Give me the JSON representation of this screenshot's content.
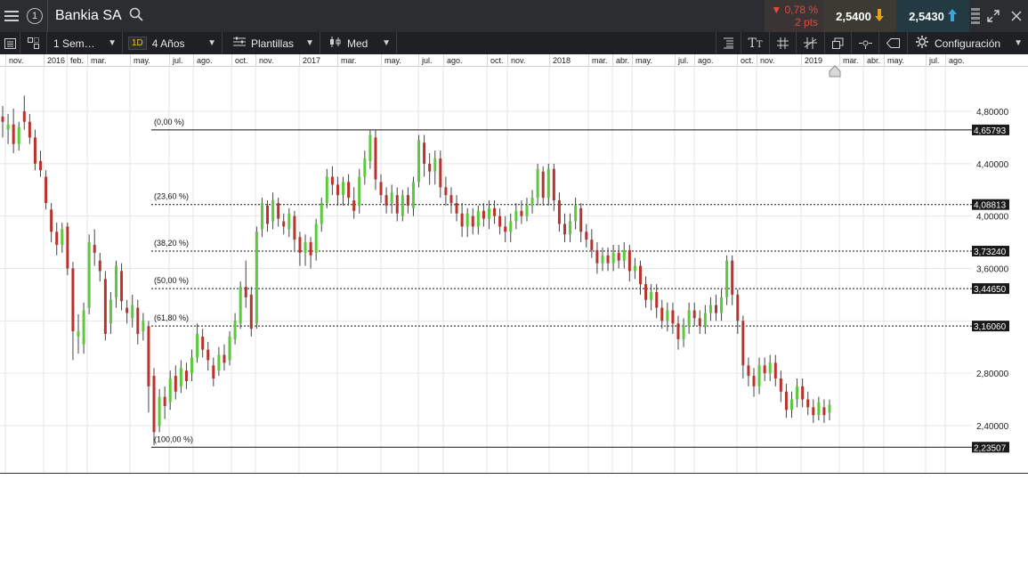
{
  "header": {
    "symbol": "Bankia SA",
    "change_pct": "▼ 0,78 %",
    "change_pts": "2 pts",
    "sell_price": "2,5400",
    "buy_price": "2,5430",
    "info_glyph": "1"
  },
  "toolbar": {
    "interval": "1 Sem…",
    "badge": "1D",
    "range": "4 Años",
    "templates": "Plantillas",
    "price_type": "Med",
    "config": "Configuración"
  },
  "icons": [
    "menu-icon",
    "info-icon",
    "search-icon",
    "list-icon",
    "layout-icon",
    "templates-icon",
    "candles-icon",
    "indicator-icon",
    "text-size-icon",
    "grid-icon",
    "drawing-icon",
    "windows-icon",
    "crosshair-icon",
    "eraser-icon",
    "gear-icon",
    "expand-icon",
    "close-icon",
    "arrow-down-icon",
    "arrow-up-icon"
  ],
  "colors": {
    "up_candle": "#5cc83c",
    "down_candle": "#b8332e",
    "loss": "#e04b3a",
    "sell_bg": "#3b3a33",
    "buy_bg": "#233a42"
  },
  "time_axis": [
    "nov.",
    "2016",
    "feb.",
    "mar.",
    "may.",
    "jul.",
    "ago.",
    "oct.",
    "nov.",
    "2017",
    "mar.",
    "may.",
    "jul.",
    "ago.",
    "oct.",
    "nov.",
    "2018",
    "mar.",
    "abr.",
    "may.",
    "jul.",
    "ago.",
    "oct.",
    "nov.",
    "2019",
    "mar.",
    "abr.",
    "may.",
    "jul.",
    "ago."
  ],
  "chart_data": {
    "type": "candlestick",
    "y_ticks": [
      "4,80000",
      "4,40000",
      "4,00000",
      "3,60000",
      "2,80000",
      "2,40000"
    ],
    "ylim": [
      2.15,
      5.15
    ],
    "fibonacci": {
      "levels": [
        {
          "label": "(0,00 %)",
          "value": 4.65793,
          "tag": "4,65793",
          "style": "solid"
        },
        {
          "label": "(23,60 %)",
          "value": 4.08813,
          "tag": "4,08813",
          "style": "dotted"
        },
        {
          "label": "(38,20 %)",
          "value": 3.7324,
          "tag": "3,73240",
          "style": "dotted"
        },
        {
          "label": "(50,00 %)",
          "value": 3.4465,
          "tag": "3,44650",
          "style": "dotted"
        },
        {
          "label": "(61,80 %)",
          "value": 3.1606,
          "tag": "3,16060",
          "style": "dotted"
        },
        {
          "label": "(100,00 %)",
          "value": 2.23507,
          "tag": "2,23507",
          "style": "solid"
        }
      ]
    },
    "candles": [
      [
        4.76,
        4.72,
        4.6,
        4.84
      ],
      [
        4.66,
        4.7,
        4.55,
        4.78
      ],
      [
        4.7,
        4.55,
        4.48,
        4.82
      ],
      [
        4.55,
        4.68,
        4.5,
        4.72
      ],
      [
        4.8,
        4.72,
        4.66,
        4.92
      ],
      [
        4.72,
        4.6,
        4.55,
        4.78
      ],
      [
        4.6,
        4.4,
        4.35,
        4.66
      ],
      [
        4.42,
        4.35,
        4.3,
        4.5
      ],
      [
        4.3,
        4.1,
        4.05,
        4.35
      ],
      [
        4.05,
        3.88,
        3.8,
        4.1
      ],
      [
        3.88,
        3.78,
        3.7,
        3.95
      ],
      [
        3.78,
        3.9,
        3.72,
        3.95
      ],
      [
        3.92,
        3.6,
        3.55,
        3.95
      ],
      [
        3.6,
        3.12,
        2.9,
        3.65
      ],
      [
        3.08,
        3.12,
        2.95,
        3.25
      ],
      [
        3.02,
        3.28,
        2.95,
        3.34
      ],
      [
        3.3,
        3.8,
        3.25,
        3.86
      ],
      [
        3.78,
        3.72,
        3.62,
        3.9
      ],
      [
        3.66,
        3.58,
        3.5,
        3.72
      ],
      [
        3.52,
        3.1,
        3.05,
        3.58
      ],
      [
        3.18,
        3.36,
        3.1,
        3.42
      ],
      [
        3.38,
        3.62,
        3.3,
        3.66
      ],
      [
        3.58,
        3.35,
        3.28,
        3.64
      ],
      [
        3.3,
        3.26,
        3.18,
        3.36
      ],
      [
        3.22,
        3.32,
        3.15,
        3.4
      ],
      [
        3.3,
        3.1,
        3.02,
        3.36
      ],
      [
        3.12,
        3.2,
        3.05,
        3.26
      ],
      [
        3.16,
        2.7,
        2.5,
        3.2
      ],
      [
        2.78,
        2.35,
        2.25,
        2.84
      ],
      [
        2.4,
        2.62,
        2.35,
        2.68
      ],
      [
        2.62,
        2.55,
        2.45,
        2.7
      ],
      [
        2.58,
        2.76,
        2.52,
        2.82
      ],
      [
        2.78,
        2.66,
        2.6,
        2.86
      ],
      [
        2.7,
        2.84,
        2.65,
        2.9
      ],
      [
        2.82,
        2.74,
        2.68,
        2.88
      ],
      [
        2.8,
        2.92,
        2.74,
        2.98
      ],
      [
        2.92,
        3.1,
        2.88,
        3.18
      ],
      [
        3.08,
        2.98,
        2.92,
        3.14
      ],
      [
        2.98,
        2.9,
        2.82,
        3.04
      ],
      [
        2.86,
        2.76,
        2.7,
        2.92
      ],
      [
        2.82,
        2.94,
        2.78,
        3.0
      ],
      [
        2.94,
        2.88,
        2.82,
        3.02
      ],
      [
        2.9,
        3.08,
        2.86,
        3.12
      ],
      [
        3.06,
        3.2,
        3.02,
        3.26
      ],
      [
        3.18,
        3.46,
        3.14,
        3.5
      ],
      [
        3.46,
        3.38,
        3.3,
        3.66
      ],
      [
        3.4,
        3.14,
        3.08,
        3.46
      ],
      [
        3.18,
        3.88,
        3.14,
        3.92
      ],
      [
        3.9,
        4.1,
        3.84,
        4.14
      ],
      [
        4.08,
        3.94,
        3.88,
        4.12
      ],
      [
        3.96,
        4.12,
        3.9,
        4.18
      ],
      [
        4.1,
        3.98,
        3.92,
        4.14
      ],
      [
        3.96,
        3.92,
        3.86,
        4.02
      ],
      [
        3.9,
        4.02,
        3.84,
        4.06
      ],
      [
        4.0,
        3.82,
        3.74,
        4.04
      ],
      [
        3.84,
        3.72,
        3.62,
        3.88
      ],
      [
        3.72,
        3.8,
        3.62,
        3.86
      ],
      [
        3.8,
        3.7,
        3.6,
        3.84
      ],
      [
        3.72,
        3.94,
        3.66,
        3.98
      ],
      [
        3.94,
        4.1,
        3.88,
        4.14
      ],
      [
        4.1,
        4.3,
        4.06,
        4.36
      ],
      [
        4.3,
        4.24,
        4.16,
        4.38
      ],
      [
        4.24,
        4.16,
        4.08,
        4.3
      ],
      [
        4.16,
        4.26,
        4.08,
        4.3
      ],
      [
        4.26,
        4.14,
        4.08,
        4.32
      ],
      [
        4.12,
        4.04,
        3.98,
        4.22
      ],
      [
        4.08,
        4.3,
        4.02,
        4.36
      ],
      [
        4.3,
        4.44,
        4.24,
        4.5
      ],
      [
        4.42,
        4.62,
        4.36,
        4.66
      ],
      [
        4.6,
        4.28,
        4.2,
        4.66
      ],
      [
        4.26,
        4.16,
        4.1,
        4.32
      ],
      [
        4.16,
        4.08,
        4.02,
        4.22
      ],
      [
        4.1,
        4.18,
        4.02,
        4.24
      ],
      [
        4.16,
        4.02,
        3.96,
        4.22
      ],
      [
        4.0,
        4.16,
        3.96,
        4.2
      ],
      [
        4.16,
        4.08,
        4.02,
        4.22
      ],
      [
        4.06,
        4.26,
        4.0,
        4.3
      ],
      [
        4.26,
        4.58,
        4.22,
        4.62
      ],
      [
        4.56,
        4.4,
        4.3,
        4.62
      ],
      [
        4.4,
        4.34,
        4.24,
        4.48
      ],
      [
        4.34,
        4.44,
        4.24,
        4.5
      ],
      [
        4.44,
        4.22,
        4.14,
        4.5
      ],
      [
        4.22,
        4.16,
        4.08,
        4.3
      ],
      [
        4.16,
        4.1,
        4.02,
        4.22
      ],
      [
        4.1,
        4.02,
        3.96,
        4.16
      ],
      [
        4.02,
        3.92,
        3.84,
        4.1
      ],
      [
        3.92,
        4.02,
        3.84,
        4.06
      ],
      [
        4.0,
        3.92,
        3.86,
        4.06
      ],
      [
        3.92,
        4.04,
        3.86,
        4.08
      ],
      [
        4.04,
        3.98,
        3.92,
        4.1
      ],
      [
        3.98,
        4.06,
        3.9,
        4.12
      ],
      [
        4.06,
        4.0,
        3.94,
        4.12
      ],
      [
        4.0,
        3.92,
        3.86,
        4.06
      ],
      [
        3.92,
        3.88,
        3.8,
        4.0
      ],
      [
        3.88,
        3.96,
        3.8,
        4.02
      ],
      [
        3.96,
        4.04,
        3.9,
        4.1
      ],
      [
        4.04,
        4.0,
        3.94,
        4.12
      ],
      [
        4.0,
        4.08,
        3.96,
        4.14
      ],
      [
        4.08,
        4.14,
        4.02,
        4.2
      ],
      [
        4.14,
        4.36,
        4.08,
        4.4
      ],
      [
        4.34,
        4.14,
        4.08,
        4.38
      ],
      [
        4.14,
        4.36,
        4.08,
        4.4
      ],
      [
        4.36,
        4.12,
        4.04,
        4.4
      ],
      [
        4.12,
        3.94,
        3.88,
        4.18
      ],
      [
        3.94,
        3.86,
        3.8,
        4.02
      ],
      [
        3.86,
        3.96,
        3.8,
        4.02
      ],
      [
        3.96,
        4.08,
        3.9,
        4.14
      ],
      [
        4.06,
        3.88,
        3.8,
        4.1
      ],
      [
        3.88,
        3.82,
        3.76,
        3.94
      ],
      [
        3.82,
        3.74,
        3.68,
        3.9
      ],
      [
        3.74,
        3.64,
        3.56,
        3.8
      ],
      [
        3.64,
        3.7,
        3.58,
        3.76
      ],
      [
        3.7,
        3.64,
        3.58,
        3.76
      ],
      [
        3.64,
        3.72,
        3.58,
        3.78
      ],
      [
        3.72,
        3.66,
        3.6,
        3.78
      ],
      [
        3.66,
        3.74,
        3.6,
        3.8
      ],
      [
        3.74,
        3.58,
        3.5,
        3.78
      ],
      [
        3.58,
        3.62,
        3.52,
        3.68
      ],
      [
        3.62,
        3.48,
        3.4,
        3.66
      ],
      [
        3.48,
        3.36,
        3.3,
        3.54
      ],
      [
        3.36,
        3.42,
        3.28,
        3.48
      ],
      [
        3.42,
        3.3,
        3.22,
        3.48
      ],
      [
        3.3,
        3.2,
        3.14,
        3.36
      ],
      [
        3.2,
        3.28,
        3.12,
        3.34
      ],
      [
        3.28,
        3.18,
        3.1,
        3.34
      ],
      [
        3.18,
        3.06,
        2.98,
        3.24
      ],
      [
        3.06,
        3.16,
        3.0,
        3.22
      ],
      [
        3.16,
        3.28,
        3.1,
        3.34
      ],
      [
        3.28,
        3.22,
        3.16,
        3.34
      ],
      [
        3.22,
        3.16,
        3.1,
        3.28
      ],
      [
        3.16,
        3.26,
        3.1,
        3.32
      ],
      [
        3.26,
        3.32,
        3.2,
        3.38
      ],
      [
        3.32,
        3.26,
        3.2,
        3.4
      ],
      [
        3.26,
        3.38,
        3.2,
        3.44
      ],
      [
        3.38,
        3.66,
        3.32,
        3.7
      ],
      [
        3.66,
        3.4,
        3.32,
        3.7
      ],
      [
        3.4,
        3.2,
        3.1,
        3.44
      ],
      [
        3.2,
        2.86,
        2.76,
        3.24
      ],
      [
        2.86,
        2.78,
        2.7,
        2.92
      ],
      [
        2.78,
        2.7,
        2.62,
        2.84
      ],
      [
        2.7,
        2.86,
        2.64,
        2.92
      ],
      [
        2.86,
        2.8,
        2.74,
        2.92
      ],
      [
        2.8,
        2.88,
        2.74,
        2.94
      ],
      [
        2.88,
        2.76,
        2.7,
        2.94
      ],
      [
        2.76,
        2.66,
        2.58,
        2.82
      ],
      [
        2.66,
        2.52,
        2.46,
        2.72
      ],
      [
        2.52,
        2.6,
        2.46,
        2.66
      ],
      [
        2.6,
        2.7,
        2.54,
        2.76
      ],
      [
        2.7,
        2.6,
        2.54,
        2.76
      ],
      [
        2.6,
        2.54,
        2.48,
        2.66
      ],
      [
        2.54,
        2.48,
        2.42,
        2.6
      ],
      [
        2.48,
        2.58,
        2.44,
        2.62
      ],
      [
        2.54,
        2.48,
        2.42,
        2.6
      ],
      [
        2.5,
        2.56,
        2.44,
        2.6
      ]
    ]
  }
}
